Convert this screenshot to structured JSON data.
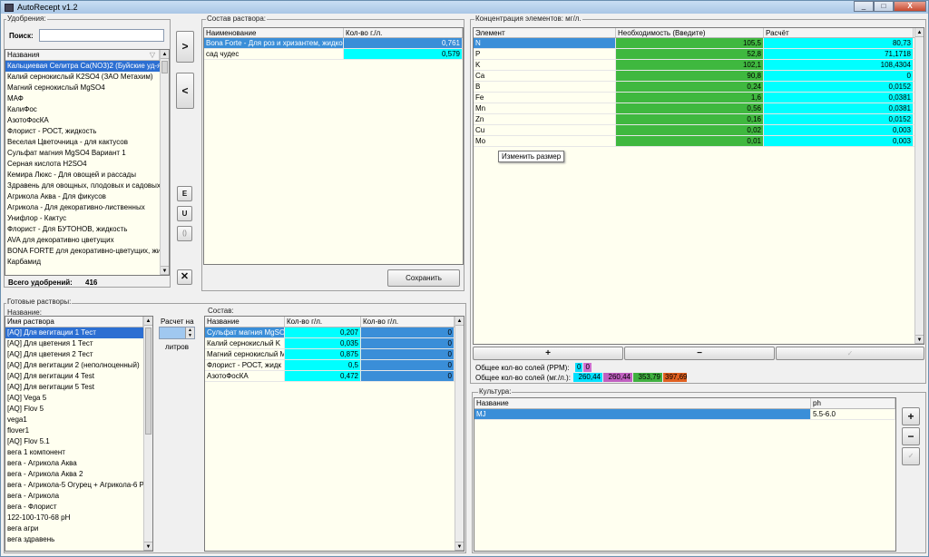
{
  "window": {
    "title": "AutoRecept v1.2",
    "min": "_",
    "max": "□",
    "close": "X"
  },
  "fert": {
    "legend": "Удобрения:",
    "search_label": "Поиск:",
    "header": "Названия",
    "sort_glyph": "▽",
    "total_label": "Всего удобрений:",
    "total_value": "416",
    "items": [
      "Кальциевая Селитра Ca(NO3)2 (Буйские уд-я)",
      "Калий сернокислый K2SO4 (ЗАО Метахим)",
      "Магний сернокислый MgSO4",
      "МАФ",
      "КалиФос",
      "АзотоФосКА",
      "Флорист - РОСТ, жидкость",
      "Веселая Цветочница - для кактусов",
      "Сульфат магния MgSO4 Вариант 1",
      "Серная кислота H2SO4",
      "Кемира Люкс - Для овощей и рассады",
      "Здравень для овощных, плодовых и садовых к",
      "Агрикола Аква - Для фикусов",
      "Агрикола - Для декоративно-лиственных",
      "Унифлор - Кактус",
      "Флорист - Для БУТОНОВ, жидкость",
      "AVA для декоративно цветущих",
      "BONA FORTE для декоративно-цветущих, жид",
      "Карбамид"
    ]
  },
  "mid_buttons": {
    "add": ">",
    "remove": "<",
    "e": "E",
    "u": "U",
    "paren": "()",
    "delete": "✕"
  },
  "composition": {
    "legend": "Состав раствора:",
    "col_name": "Наименование",
    "col_qty": "Кол-во г./л.",
    "save": "Сохранить",
    "rows": [
      {
        "name": "Bona Forte - Для роз и хризантем, жидкос",
        "qty": "0,761"
      },
      {
        "name": "сад чудес",
        "qty": "0,579"
      }
    ]
  },
  "conc": {
    "legend": "Концентрация элементов: мг/л.",
    "col_el": "Элемент",
    "col_need": "Необходимость (Введите)",
    "col_calc": "Расчёт",
    "tooltip": "Изменить размер",
    "rows": [
      {
        "el": "N",
        "need": "105,5",
        "calc": "80,73"
      },
      {
        "el": "P",
        "need": "52,8",
        "calc": "71,1718"
      },
      {
        "el": "K",
        "need": "102,1",
        "calc": "108,4304"
      },
      {
        "el": "Ca",
        "need": "90,8",
        "calc": "0"
      },
      {
        "el": "B",
        "need": "0,24",
        "calc": "0,0152"
      },
      {
        "el": "Fe",
        "need": "1,6",
        "calc": "0,0381"
      },
      {
        "el": "Mn",
        "need": "0,56",
        "calc": "0,0381"
      },
      {
        "el": "Zn",
        "need": "0,16",
        "calc": "0,0152"
      },
      {
        "el": "Cu",
        "need": "0,02",
        "calc": "0,003"
      },
      {
        "el": "Mo",
        "need": "0,01",
        "calc": "0,003"
      }
    ],
    "plus": "+",
    "minus": "−",
    "check": "✓",
    "salts_ppm_label": "Общее кол-во солей (PPM):",
    "salts_ppm": [
      "0",
      "0"
    ],
    "salts_mg_label": "Общее кол-во солей (мг./л.):",
    "salts_mg": [
      "260,44",
      "260,44",
      "353,79",
      "397,69"
    ]
  },
  "ready": {
    "legend": "Готовые растворы:",
    "sub_legend": "Название:",
    "header": "Имя раствора",
    "items": [
      "[AQ] Для вегитации 1 Тест",
      "[AQ] Для цветения 1 Тест",
      "[AQ] Для цветения 2 Тест",
      "[AQ] Для вегитации 2 (неполноценный)",
      "[AQ] Для вегитации 4 Test",
      "[AQ] Для вегитации 5 Test",
      "[AQ] Vega 5",
      "[AQ] Flov 5",
      "vega1",
      "flover1",
      "[AQ] Flov 5.1",
      "вега 1 компонент",
      "вега - Агрикола Аква",
      "вега - Агрикола Аква 2",
      "вега - Агрикола-5 Огурец + Агрикола-6 Р.",
      "вега - Агрикола",
      "вега - Флорист",
      "122-100-170-68 pH",
      "вега агри",
      "вега здравень"
    ],
    "calc_label": "Расчет на",
    "liters": "литров"
  },
  "sostav": {
    "legend": "Состав:",
    "col_name": "Название",
    "col_q1": "Кол-во г/л.",
    "col_q2": "Кол-во г/л.",
    "rows": [
      {
        "name": "Сульфат магния MgSO4",
        "q1": "0,207",
        "q2": "0"
      },
      {
        "name": "Калий сернокислый K",
        "q1": "0,035",
        "q2": "0"
      },
      {
        "name": "Магний сернокислый M",
        "q1": "0,875",
        "q2": "0"
      },
      {
        "name": "Флорист - РОСТ, жидк",
        "q1": "0,5",
        "q2": "0"
      },
      {
        "name": "АзотоФосКА",
        "q1": "0,472",
        "q2": "0"
      }
    ]
  },
  "culture": {
    "legend": "Культура:",
    "col_name": "Название",
    "col_ph": "ph",
    "rows": [
      {
        "name": "MJ",
        "ph": "5.5-6.0"
      }
    ],
    "plus": "+",
    "minus": "−",
    "check": "✓"
  }
}
